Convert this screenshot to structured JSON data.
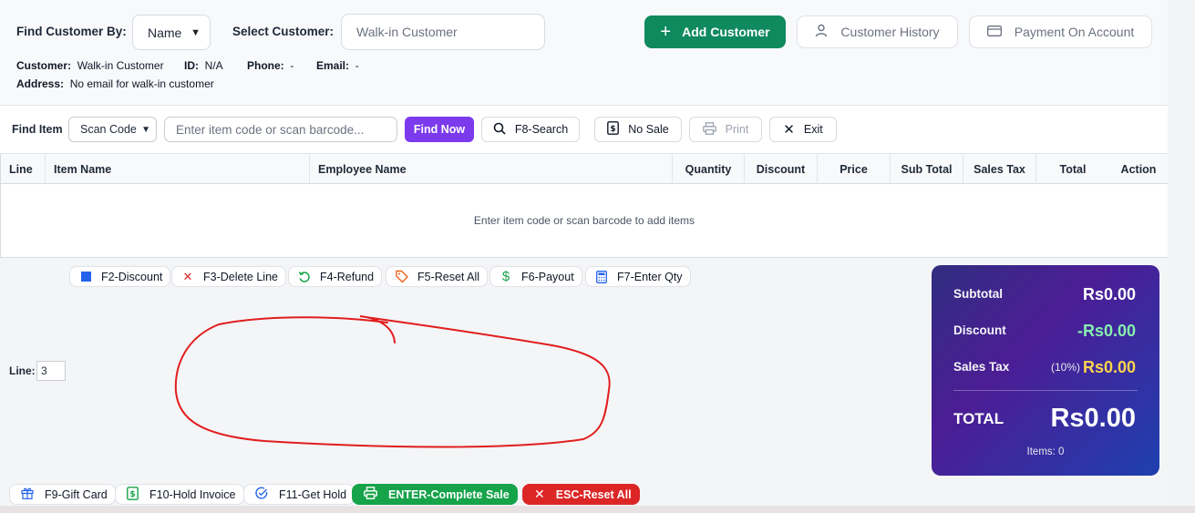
{
  "customer_bar": {
    "find_by_label": "Find Customer By:",
    "find_by_value": "Name",
    "select_label": "Select Customer:",
    "select_placeholder": "Walk-in Customer",
    "add_customer": "Add Customer",
    "customer_history": "Customer History",
    "payment_on_account": "Payment On Account"
  },
  "customer_info": {
    "customer_label": "Customer:",
    "customer_value": "Walk-in Customer",
    "id_label": "ID:",
    "id_value": "N/A",
    "phone_label": "Phone:",
    "phone_value": "-",
    "email_label": "Email:",
    "email_value": "-",
    "address_label": "Address:",
    "address_value": "No email for walk-in customer"
  },
  "find_item": {
    "label": "Find Item",
    "mode": "Scan Code",
    "placeholder": "Enter item code or scan barcode...",
    "find_now": "Find Now",
    "search": "F8-Search",
    "no_sale": "No Sale",
    "print": "Print",
    "exit": "Exit"
  },
  "table": {
    "columns": [
      "Line",
      "Item Name",
      "Employee Name",
      "Quantity",
      "Discount",
      "Price",
      "Sub Total",
      "Sales Tax",
      "Total",
      "Action"
    ],
    "empty_message": "Enter item code or scan barcode to add items"
  },
  "function_keys": {
    "f2": "F2-Discount",
    "f3": "F3-Delete Line",
    "f4": "F4-Refund",
    "f5": "F5-Reset All",
    "f6": "F6-Payout",
    "f7": "F7-Enter Qty"
  },
  "line": {
    "label": "Line:",
    "value": "3"
  },
  "bottom_actions": {
    "f9": "F9-Gift Card",
    "f10": "F10-Hold Invoice",
    "f11": "F11-Get Hold",
    "enter": "ENTER-Complete Sale",
    "esc": "ESC-Reset All"
  },
  "totals": {
    "subtotal_label": "Subtotal",
    "subtotal_value": "Rs0.00",
    "discount_label": "Discount",
    "discount_value": "-Rs0.00",
    "tax_label": "Sales Tax",
    "tax_rate": "(10%)",
    "tax_value": "Rs0.00",
    "total_label": "TOTAL",
    "total_value": "Rs0.00",
    "items_label": "Items: 0"
  },
  "colors": {
    "primary_green": "#0f8a5f",
    "purple": "#7c3aed",
    "danger": "#dc2626",
    "discount_green": "#86efac",
    "tax_yellow": "#fcd34d",
    "annotation_red": "#e11d1d"
  }
}
